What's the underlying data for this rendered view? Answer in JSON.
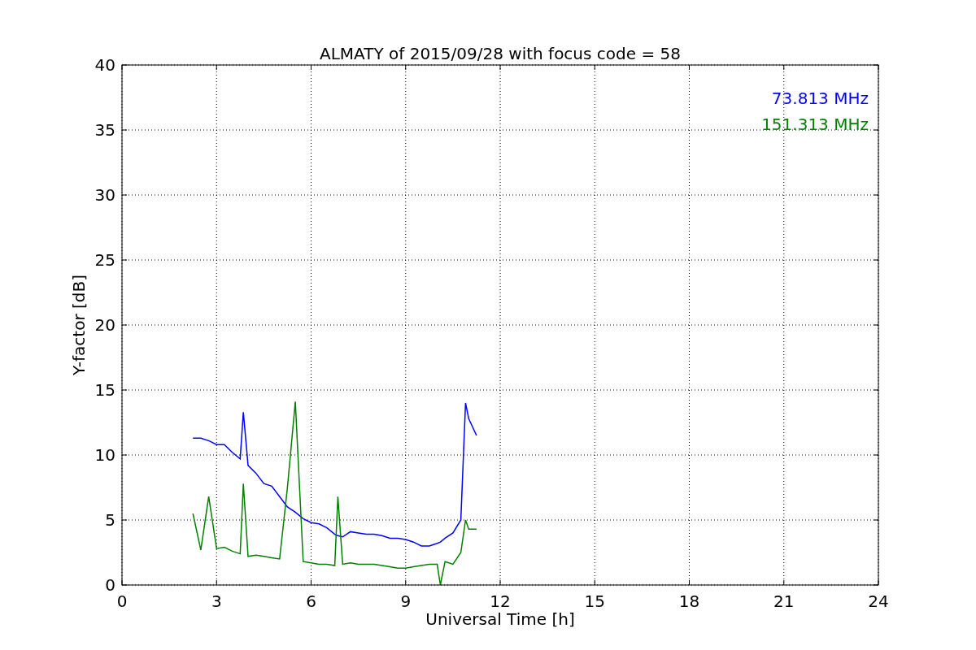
{
  "chart_data": {
    "type": "line",
    "title": "ALMATY of 2015/09/28 with focus code = 58",
    "xlabel": "Universal Time [h]",
    "ylabel": "Y-factor [dB]",
    "x": [
      2.25,
      2.5,
      2.75,
      3,
      3.25,
      3.5,
      3.75,
      3.85,
      4,
      4.25,
      4.5,
      4.75,
      5,
      5.25,
      5.5,
      5.75,
      6,
      6.25,
      6.5,
      6.75,
      6.85,
      7,
      7.25,
      7.5,
      7.75,
      8,
      8.25,
      8.5,
      8.75,
      9,
      9.25,
      9.5,
      9.75,
      10,
      10.1,
      10.25,
      10.5,
      10.75,
      10.9,
      11,
      11.25
    ],
    "series": [
      {
        "name": "73.813 MHz",
        "color": "#0000ff",
        "values": [
          11.3,
          11.3,
          11.1,
          10.8,
          10.8,
          10.2,
          9.7,
          13.3,
          9.2,
          8.6,
          7.8,
          7.6,
          6.8,
          6.0,
          5.6,
          5.1,
          4.8,
          4.7,
          4.4,
          3.9,
          3.8,
          3.7,
          4.1,
          4.0,
          3.9,
          3.9,
          3.8,
          3.6,
          3.6,
          3.5,
          3.3,
          3.0,
          3.0,
          3.2,
          3.3,
          3.6,
          4.0,
          5.0,
          14.0,
          12.8,
          11.5
        ]
      },
      {
        "name": "151.313 MHz",
        "color": "#008000",
        "values": [
          5.5,
          2.7,
          6.8,
          2.8,
          2.9,
          2.6,
          2.4,
          7.8,
          2.2,
          2.3,
          2.2,
          2.1,
          2.0,
          7.5,
          14.1,
          1.8,
          1.7,
          1.6,
          1.6,
          1.5,
          6.8,
          1.6,
          1.7,
          1.6,
          1.6,
          1.6,
          1.5,
          1.4,
          1.3,
          1.3,
          1.4,
          1.5,
          1.6,
          1.6,
          0,
          1.8,
          1.6,
          2.5,
          5.0,
          4.3,
          4.3
        ]
      }
    ],
    "xlim": [
      0,
      24
    ],
    "ylim": [
      0,
      40
    ],
    "xticks": [
      0,
      3,
      6,
      9,
      12,
      15,
      18,
      21,
      24
    ],
    "yticks": [
      0,
      5,
      10,
      15,
      20,
      25,
      30,
      35,
      40
    ],
    "grid": true
  }
}
